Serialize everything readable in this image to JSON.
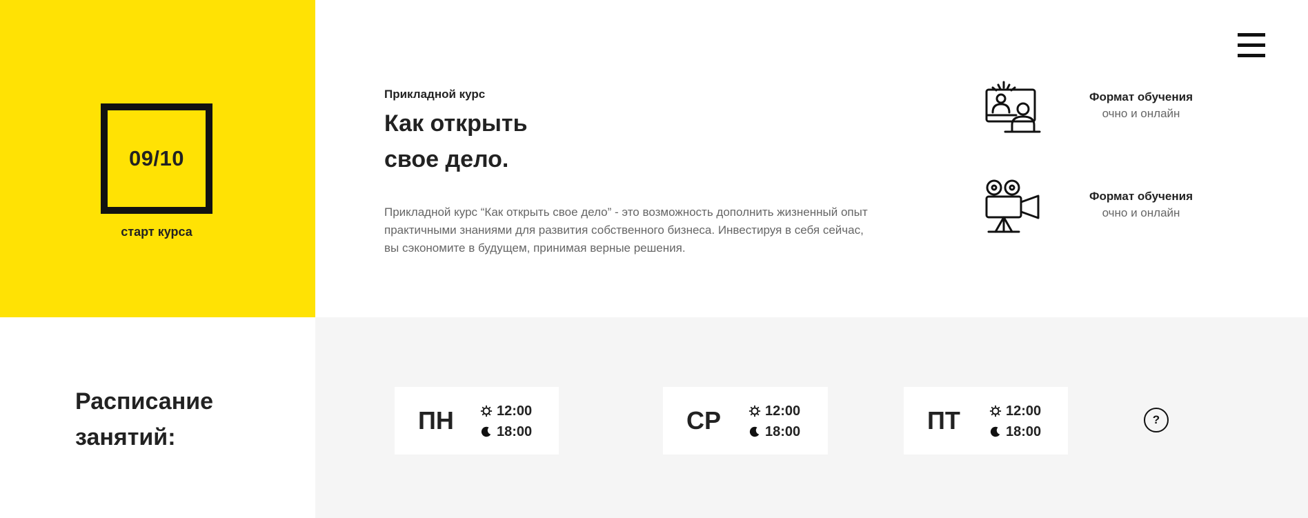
{
  "hero": {
    "date": "09/10",
    "start_label": "старт курса",
    "eyebrow": "Прикладной курс",
    "title_line1": "Как открыть",
    "title_line2": "свое дело.",
    "description": "Прикладной курс “Как открыть свое дело” - это возможность дополнить жизненный опыт практичными знаниями для развития собственного бизнеса. Инвестируя в себя сейчас, вы сэкономите в будущем, принимая верные решения."
  },
  "features": [
    {
      "icon": "online-meeting-icon",
      "title": "Формат обучения",
      "value": "очно и онлайн"
    },
    {
      "icon": "video-camera-icon",
      "title": "Формат обучения",
      "value": "очно и онлайн"
    }
  ],
  "schedule": {
    "title_line1": "Расписание",
    "title_line2": "занятий:",
    "days": [
      {
        "day": "ПН",
        "morning": "12:00",
        "evening": "18:00"
      },
      {
        "day": "СР",
        "morning": "12:00",
        "evening": "18:00"
      },
      {
        "day": "ПТ",
        "morning": "12:00",
        "evening": "18:00"
      }
    ],
    "help_label": "?"
  },
  "colors": {
    "accent": "#ffe204",
    "panel_gray": "#f5f5f5",
    "text_dark": "#222222",
    "text_muted": "#666666"
  }
}
